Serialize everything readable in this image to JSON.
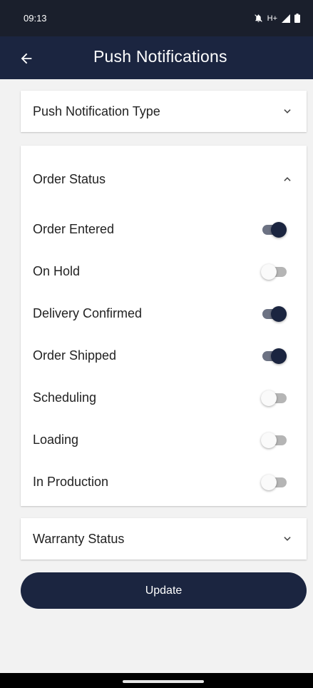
{
  "status_bar": {
    "time": "09:13",
    "icons": [
      "notifications-off-icon",
      "h-plus-network-icon",
      "cell-signal-icon",
      "battery-icon"
    ],
    "network_label": "H+"
  },
  "app_bar": {
    "title": "Push Notifications",
    "back_icon": "back-arrow-icon"
  },
  "sections": {
    "push_type": {
      "title": "Push Notification Type",
      "expanded": false
    },
    "order_status": {
      "title": "Order Status",
      "expanded": true,
      "items": [
        {
          "label": "Order Entered",
          "enabled": true
        },
        {
          "label": "On Hold",
          "enabled": false
        },
        {
          "label": "Delivery Confirmed",
          "enabled": true
        },
        {
          "label": "Order Shipped",
          "enabled": true
        },
        {
          "label": "Scheduling",
          "enabled": false
        },
        {
          "label": "Loading",
          "enabled": false
        },
        {
          "label": "In Production",
          "enabled": false
        }
      ]
    },
    "warranty_status": {
      "title": "Warranty Status",
      "expanded": false
    }
  },
  "update_label": "Update",
  "colors": {
    "primary": "#1b2540",
    "status_bar": "#1a1f2c",
    "background": "#f2f2f2",
    "toggle_on_track": "#6c7283",
    "toggle_off_track": "#b5b5b5"
  }
}
